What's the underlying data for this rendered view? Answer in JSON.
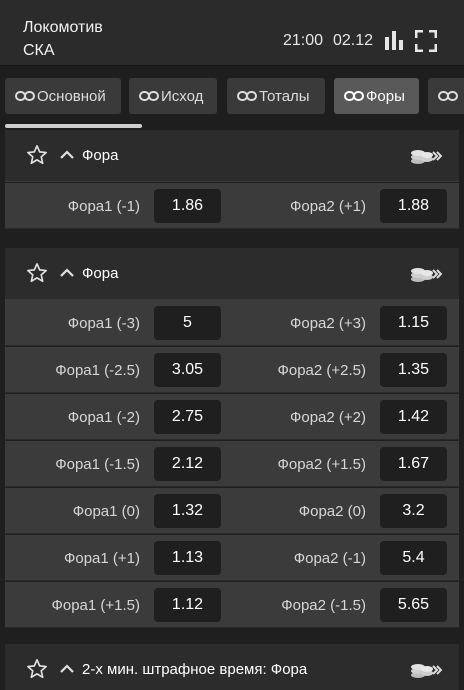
{
  "header": {
    "team1": "Локомотив",
    "team2": "СКА",
    "time": "21:00",
    "date": "02.12",
    "icons": [
      "stats-icon",
      "fullscreen-icon"
    ]
  },
  "tabs": [
    {
      "label": "Основной",
      "active": false
    },
    {
      "label": "Исход",
      "active": false
    },
    {
      "label": "Тоталы",
      "active": false
    },
    {
      "label": "Форы",
      "active": true
    },
    {
      "label": "",
      "active": false
    }
  ],
  "markets": [
    {
      "title": "Фора",
      "rows": [
        {
          "l1": "Фора1 (-1)",
          "o1": "1.86",
          "l2": "Фора2 (+1)",
          "o2": "1.88"
        }
      ]
    },
    {
      "title": "Фора",
      "rows": [
        {
          "l1": "Фора1 (-3)",
          "o1": "5",
          "l2": "Фора2 (+3)",
          "o2": "1.15"
        },
        {
          "l1": "Фора1 (-2.5)",
          "o1": "3.05",
          "l2": "Фора2 (+2.5)",
          "o2": "1.35"
        },
        {
          "l1": "Фора1 (-2)",
          "o1": "2.75",
          "l2": "Фора2 (+2)",
          "o2": "1.42"
        },
        {
          "l1": "Фора1 (-1.5)",
          "o1": "2.12",
          "l2": "Фора2 (+1.5)",
          "o2": "1.67"
        },
        {
          "l1": "Фора1 (0)",
          "o1": "1.32",
          "l2": "Фора2 (0)",
          "o2": "3.2"
        },
        {
          "l1": "Фора1 (+1)",
          "o1": "1.13",
          "l2": "Фора2 (-1)",
          "o2": "5.4"
        },
        {
          "l1": "Фора1 (+1.5)",
          "o1": "1.12",
          "l2": "Фора2 (-1.5)",
          "o2": "5.65"
        }
      ]
    },
    {
      "title": "2-х мин. штрафное время: Фора",
      "rows": []
    }
  ],
  "colors": {
    "background": "#1f1f1f",
    "header": "#2b2b2b",
    "row": "#3b3b3b",
    "odd_button": "#1f1f1f",
    "active_tab": "#595959"
  }
}
